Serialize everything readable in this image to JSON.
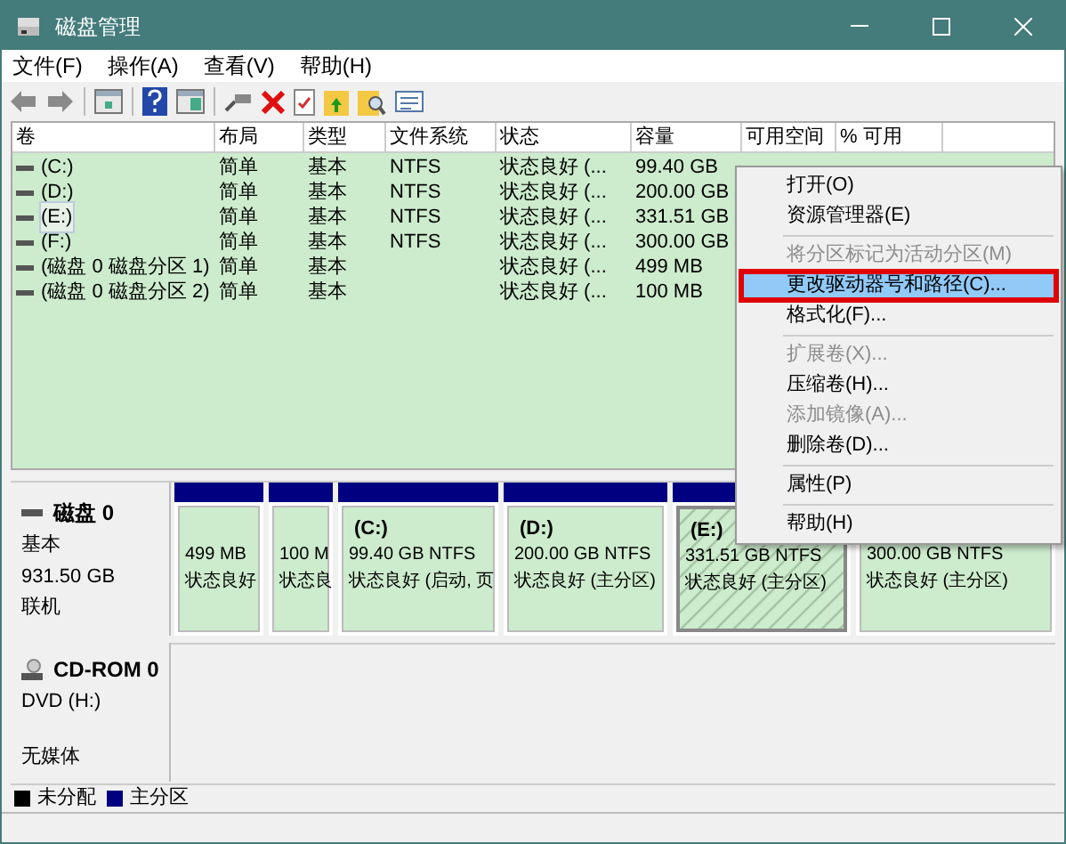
{
  "window": {
    "title": "磁盘管理"
  },
  "menu_bar": [
    "文件(F)",
    "操作(A)",
    "查看(V)",
    "帮助(H)"
  ],
  "table": {
    "columns": [
      "卷",
      "布局",
      "类型",
      "文件系统",
      "状态",
      "容量",
      "可用空间",
      "% 可用"
    ],
    "rows": [
      {
        "selected": false,
        "cells": [
          "(C:)",
          "简单",
          "基本",
          "NTFS",
          "状态良好 (...",
          "99.40 GB"
        ]
      },
      {
        "selected": false,
        "cells": [
          "(D:)",
          "简单",
          "基本",
          "NTFS",
          "状态良好 (...",
          "200.00 GB"
        ]
      },
      {
        "selected": true,
        "cells": [
          "(E:)",
          "简单",
          "基本",
          "NTFS",
          "状态良好 (...",
          "331.51 GB"
        ]
      },
      {
        "selected": false,
        "cells": [
          "(F:)",
          "简单",
          "基本",
          "NTFS",
          "状态良好 (...",
          "300.00 GB"
        ]
      },
      {
        "selected": false,
        "cells": [
          "(磁盘 0 磁盘分区 1)",
          "简单",
          "基本",
          "",
          "状态良好 (...",
          "499 MB"
        ]
      },
      {
        "selected": false,
        "cells": [
          "(磁盘 0 磁盘分区 2)",
          "简单",
          "基本",
          "",
          "状态良好 (...",
          "100 MB"
        ]
      }
    ]
  },
  "disk": {
    "name": "磁盘 0",
    "type": "基本",
    "size": "931.50 GB",
    "status": "联机",
    "partitions": [
      {
        "size": "499 MB",
        "status": "状态良好",
        "selected": false
      },
      {
        "size": "100 M",
        "status": "状态良",
        "selected": false
      },
      {
        "label": "(C:)",
        "size": "99.40 GB NTFS",
        "status": "状态良好 (启动, 页",
        "selected": false
      },
      {
        "label": "(D:)",
        "size": "200.00 GB NTFS",
        "status": "状态良好 (主分区)",
        "selected": false
      },
      {
        "label": "(E:)",
        "size": "331.51 GB NTFS",
        "status": "状态良好 (主分区)",
        "selected": true
      },
      {
        "size": "300.00 GB NTFS",
        "status": "状态良好 (主分区)",
        "selected": false
      }
    ]
  },
  "cdrom": {
    "name": "CD-ROM 0",
    "drive": "DVD (H:)",
    "status": "无媒体"
  },
  "legend": [
    {
      "label": "未分配",
      "color": "#000000"
    },
    {
      "label": "主分区",
      "color": "#000080"
    }
  ],
  "context_menu": {
    "items": [
      {
        "kind": "item",
        "label": "打开(O)",
        "disabled": false,
        "highlighted": false
      },
      {
        "kind": "item",
        "label": "资源管理器(E)",
        "disabled": false,
        "highlighted": false
      },
      {
        "kind": "separator"
      },
      {
        "kind": "item",
        "label": "将分区标记为活动分区(M)",
        "disabled": true,
        "highlighted": false
      },
      {
        "kind": "item",
        "label": "更改驱动器号和路径(C)...",
        "disabled": false,
        "highlighted": true
      },
      {
        "kind": "item",
        "label": "格式化(F)...",
        "disabled": false,
        "highlighted": false
      },
      {
        "kind": "separator"
      },
      {
        "kind": "item",
        "label": "扩展卷(X)...",
        "disabled": true,
        "highlighted": false
      },
      {
        "kind": "item",
        "label": "压缩卷(H)...",
        "disabled": false,
        "highlighted": false
      },
      {
        "kind": "item",
        "label": "添加镜像(A)...",
        "disabled": true,
        "highlighted": false
      },
      {
        "kind": "item",
        "label": "删除卷(D)...",
        "disabled": false,
        "highlighted": false
      },
      {
        "kind": "separator"
      },
      {
        "kind": "item",
        "label": "属性(P)",
        "disabled": false,
        "highlighted": false
      },
      {
        "kind": "separator"
      },
      {
        "kind": "item",
        "label": "帮助(H)",
        "disabled": false,
        "highlighted": false
      }
    ]
  }
}
